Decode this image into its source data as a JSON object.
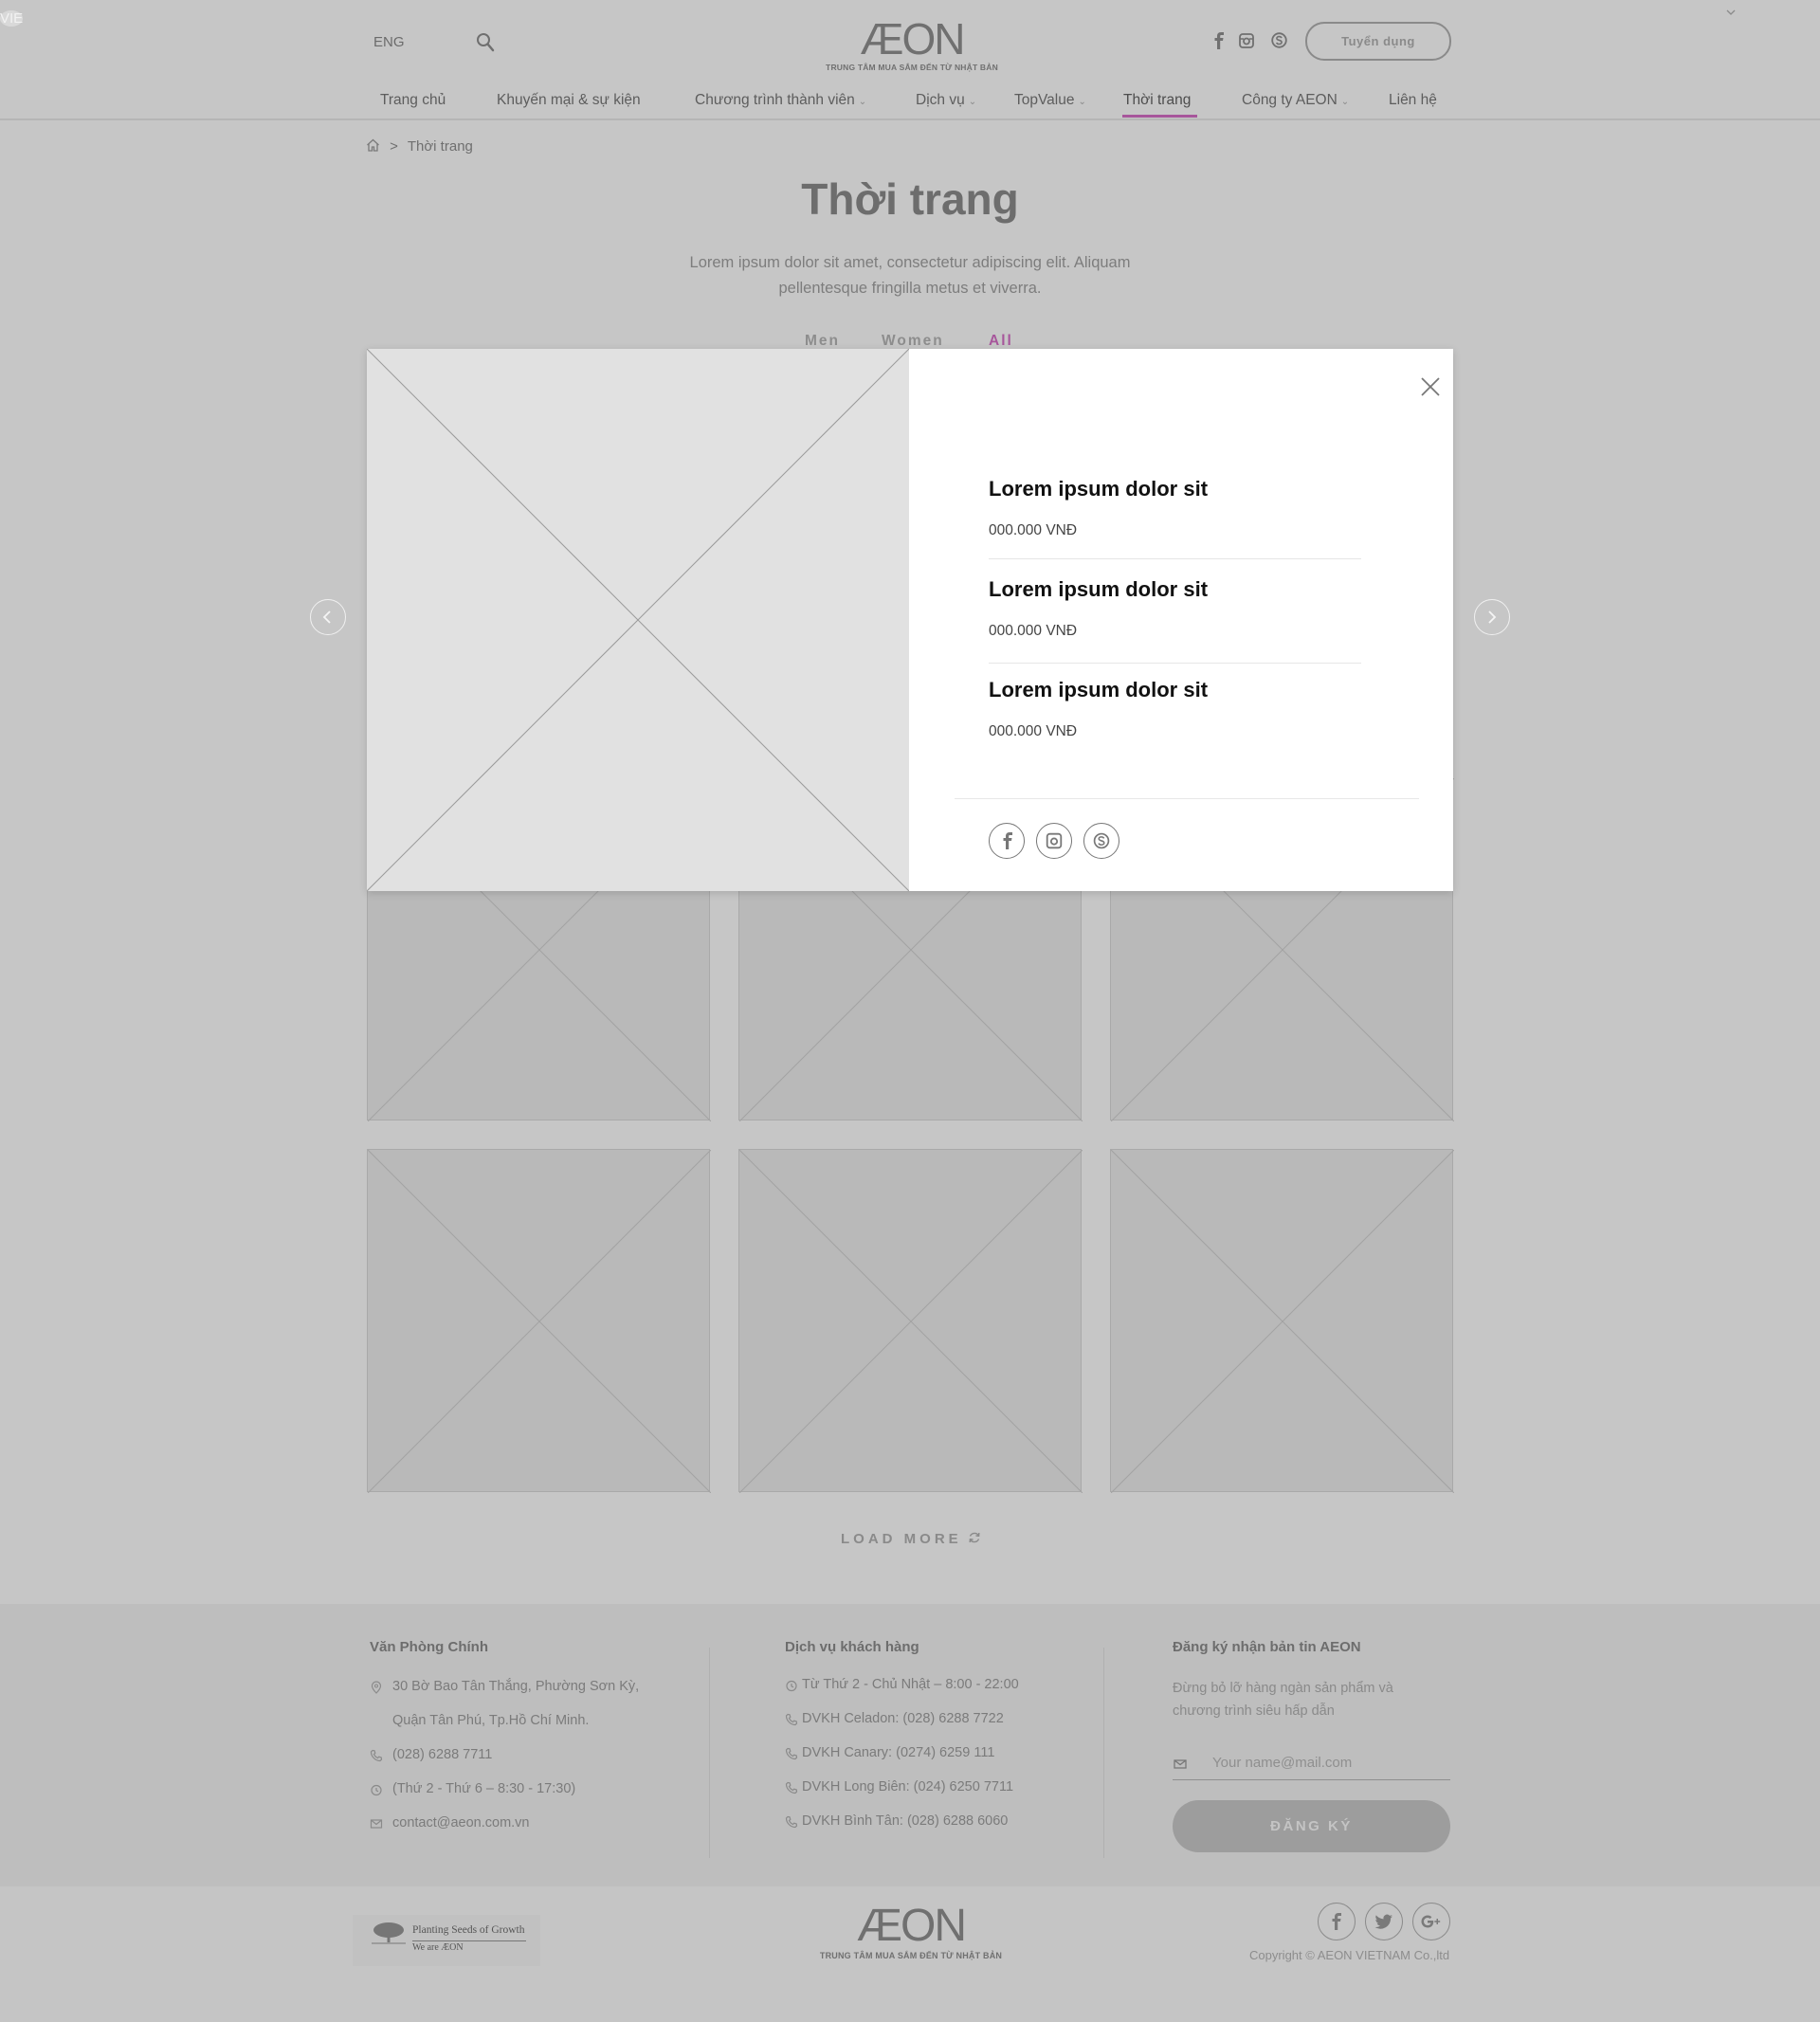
{
  "header": {
    "lang_eng": "ENG",
    "lang_vie": "VIE",
    "logo_text": "ÆON",
    "logo_subtitle": "TRUNG TÂM MUA SẮM ĐẾN TỪ NHẬT BẢN",
    "recruit_label": "Tuyển dụng",
    "nav": [
      {
        "label": "Trang chủ"
      },
      {
        "label": "Khuyến mại & sự kiện"
      },
      {
        "label": "Chương trình thành viên"
      },
      {
        "label": "Dịch vụ"
      },
      {
        "label": "TopValue"
      },
      {
        "label": "Thời trang"
      },
      {
        "label": "Công ty AEON"
      },
      {
        "label": "Liên hệ"
      }
    ],
    "active_nav": "Thời trang",
    "chevron": "⌄"
  },
  "breadcrumb": {
    "separator": ">",
    "current": "Thời trang"
  },
  "page": {
    "title": "Thời trang",
    "description": "Lorem ipsum dolor sit amet, consectetur adipiscing elit. Aliquam pellentesque fringilla metus et viverra.",
    "filters": [
      "Men",
      "Women",
      "All"
    ],
    "active_filter": "All",
    "load_more": "LOAD MORE"
  },
  "modal": {
    "items": [
      {
        "title": "Lorem ipsum dolor sit",
        "price": "000.000 VNĐ"
      },
      {
        "title": "Lorem ipsum dolor sit",
        "price": "000.000 VNĐ"
      },
      {
        "title": "Lorem ipsum dolor sit",
        "price": "000.000 VNĐ"
      }
    ],
    "social": [
      "facebook-icon",
      "instagram-icon",
      "skype-icon"
    ]
  },
  "footer": {
    "office": {
      "heading": "Văn Phòng Chính",
      "address_1": "30 Bờ Bao Tân Thắng, Phường Sơn Kỳ,",
      "address_2": "Quận Tân Phú, Tp.Hồ Chí Minh.",
      "phone": "(028) 6288 7711",
      "hours": "(Thứ 2 - Thứ 6 – 8:30 - 17:30)",
      "email": "contact@aeon.com.vn"
    },
    "service": {
      "heading": "Dịch vụ khách hàng",
      "hours": "Từ Thứ 2 - Chủ Nhật – 8:00 - 22:00",
      "lines": [
        "DVKH Celadon: (028) 6288 7722",
        "DVKH Canary: (0274) 6259 111",
        "DVKH Long Biên: (024) 6250 7711",
        "DVKH Bình Tân: (028) 6288 6060"
      ]
    },
    "newsletter": {
      "heading": "Đăng ký nhận bản tin AEON",
      "description": "Đừng bỏ lỡ hàng ngàn sản phẩm và chương trình siêu hấp dẫn",
      "placeholder": "Your name@mail.com",
      "button": "ĐĂNG KÝ"
    },
    "badge_title": "Planting Seeds of Growth",
    "badge_sub": "We are ÆON",
    "logo_text": "ÆON",
    "logo_subtitle": "TRUNG TÂM MUA SẮM ĐẾN TỪ NHẬT BẢN",
    "social": [
      "facebook-icon",
      "twitter-icon",
      "google-plus-icon"
    ],
    "copyright": "Copyright © AEON VIETNAM Co.,ltd"
  },
  "colors": {
    "accent": "#a7569b",
    "overlay_bg": "#c6c6c6",
    "modal_bg": "#ffffff"
  }
}
